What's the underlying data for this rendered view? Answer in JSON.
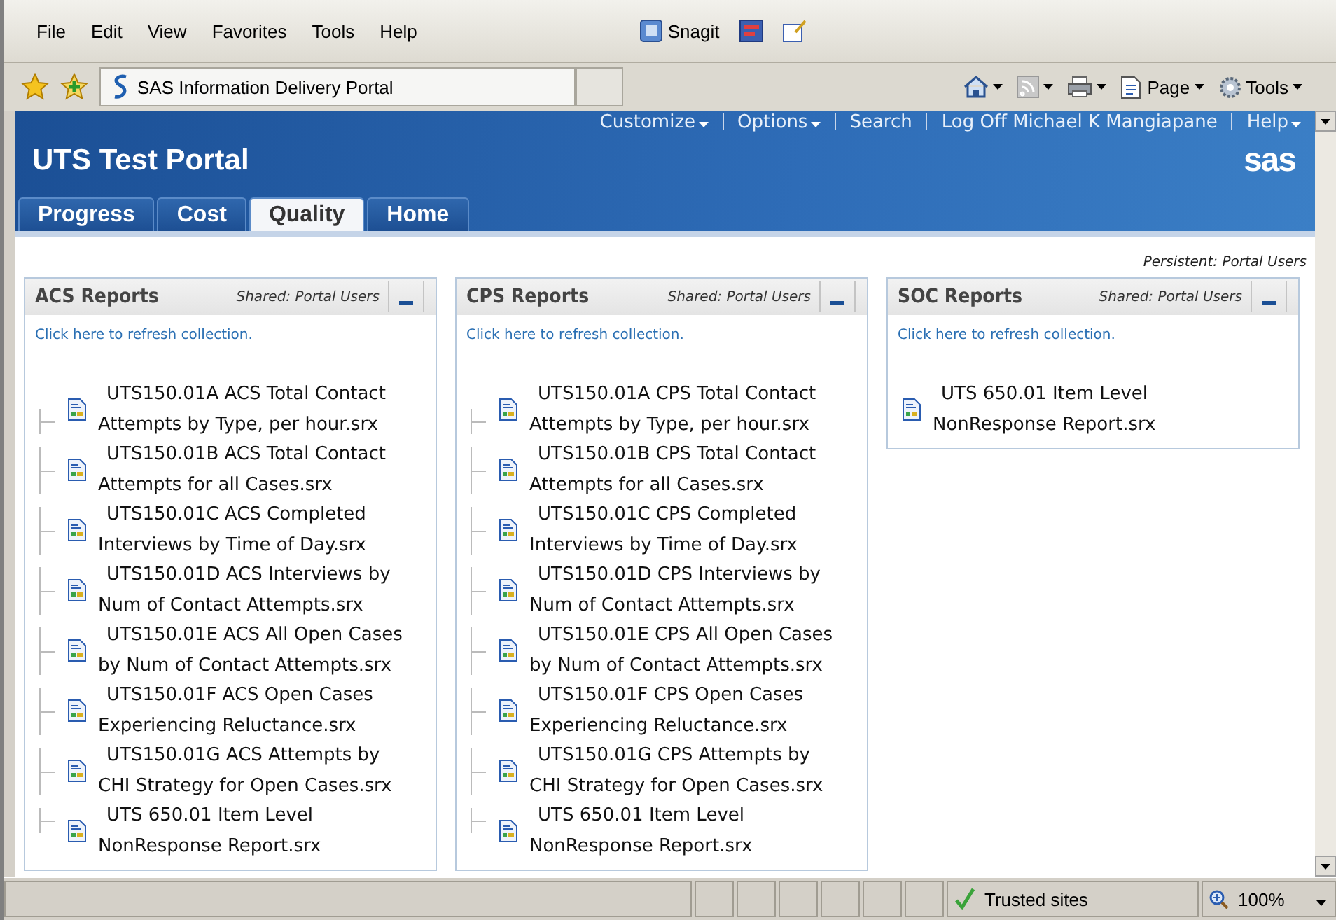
{
  "menu_bar": {
    "items": [
      "File",
      "Edit",
      "View",
      "Favorites",
      "Tools",
      "Help"
    ],
    "snagit": "Snagit"
  },
  "address_bar": {
    "tab_title": "SAS Information Delivery Portal",
    "commands": [
      {
        "kind": "home"
      },
      {
        "kind": "feed"
      },
      {
        "kind": "print"
      },
      {
        "kind": "page",
        "label": "Page"
      },
      {
        "kind": "tools",
        "label": "Tools"
      }
    ]
  },
  "portal": {
    "links": [
      {
        "label": "Customize",
        "dropdown": true
      },
      {
        "label": "Options",
        "dropdown": true
      },
      {
        "label": "Search",
        "dropdown": false
      },
      {
        "label": "Log Off Michael K Mangiapane",
        "dropdown": false
      },
      {
        "label": "Help",
        "dropdown": true
      }
    ],
    "title": "UTS Test Portal",
    "logo": "sas",
    "tabs": [
      {
        "label": "Progress",
        "selected": false
      },
      {
        "label": "Cost",
        "selected": false
      },
      {
        "label": "Quality",
        "selected": true
      },
      {
        "label": "Home",
        "selected": false
      }
    ],
    "persistent": "Persistent: Portal Users"
  },
  "panels": [
    {
      "title": "ACS Reports",
      "shared": "Shared: Portal Users",
      "refresh": "Click here to refresh collection.",
      "items": [
        {
          "lines": [
            "UTS150.01A ACS Total Contact",
            "Attempts by Type, per hour.srx"
          ]
        },
        {
          "lines": [
            "UTS150.01B ACS Total Contact",
            "Attempts for all Cases.srx"
          ]
        },
        {
          "lines": [
            "UTS150.01C ACS Completed",
            "Interviews by Time of Day.srx"
          ]
        },
        {
          "lines": [
            "UTS150.01D ACS Interviews by",
            "Num of Contact Attempts.srx"
          ]
        },
        {
          "lines": [
            "UTS150.01E ACS All Open Cases",
            "by Num of Contact Attempts.srx"
          ]
        },
        {
          "lines": [
            "UTS150.01F ACS Open Cases",
            "Experiencing Reluctance.srx"
          ]
        },
        {
          "lines": [
            "UTS150.01G ACS Attempts by",
            "CHI Strategy for Open Cases.srx"
          ]
        },
        {
          "lines": [
            "UTS 650.01 Item Level",
            "NonResponse Report.srx"
          ]
        }
      ]
    },
    {
      "title": "CPS Reports",
      "shared": "Shared: Portal Users",
      "refresh": "Click here to refresh collection.",
      "items": [
        {
          "lines": [
            "UTS150.01A CPS Total Contact",
            "Attempts by Type, per hour.srx"
          ]
        },
        {
          "lines": [
            "UTS150.01B CPS Total Contact",
            "Attempts for all Cases.srx"
          ]
        },
        {
          "lines": [
            "UTS150.01C CPS Completed",
            "Interviews by Time of Day.srx"
          ]
        },
        {
          "lines": [
            "UTS150.01D CPS Interviews by",
            "Num of Contact Attempts.srx"
          ]
        },
        {
          "lines": [
            "UTS150.01E CPS All Open Cases",
            "by Num of Contact Attempts.srx"
          ]
        },
        {
          "lines": [
            "UTS150.01F CPS Open Cases",
            "Experiencing Reluctance.srx"
          ]
        },
        {
          "lines": [
            "UTS150.01G CPS Attempts by",
            "CHI Strategy for Open Cases.srx"
          ]
        },
        {
          "lines": [
            "UTS 650.01 Item Level",
            "NonResponse Report.srx"
          ]
        }
      ]
    },
    {
      "title": "SOC Reports",
      "shared": "Shared: Portal Users",
      "refresh": "Click here to refresh collection.",
      "items": [
        {
          "lines": [
            "UTS 650.01 Item Level",
            "NonResponse Report.srx"
          ]
        }
      ]
    }
  ],
  "status_bar": {
    "zone": "Trusted sites",
    "zoom": "100%"
  }
}
